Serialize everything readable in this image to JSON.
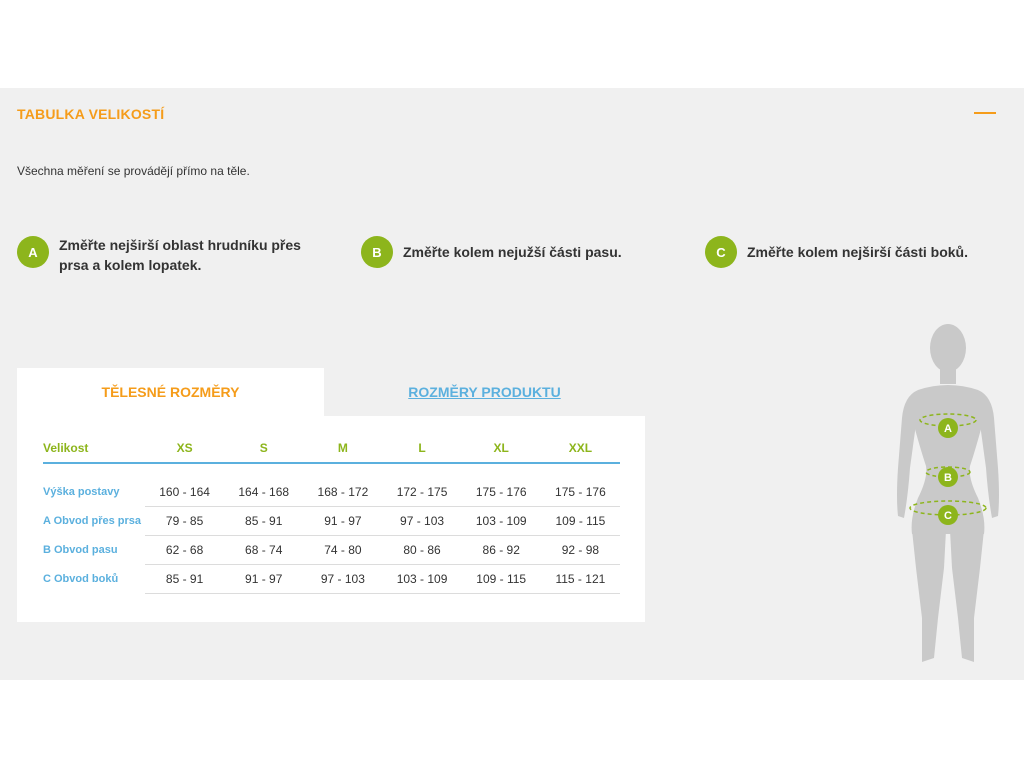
{
  "header": {
    "title": "TABULKA VELIKOSTÍ"
  },
  "intro": "Všechna měření se provádějí přímo na těle.",
  "steps": [
    {
      "badge": "A",
      "text": "Změřte nejširší oblast hrudníku přes prsa a kolem lopatek."
    },
    {
      "badge": "B",
      "text": "Změřte kolem nejužší části pasu."
    },
    {
      "badge": "C",
      "text": "Změřte kolem nejširší části boků."
    }
  ],
  "tabs": [
    {
      "label": "TĚLESNÉ ROZMĚRY",
      "active": true
    },
    {
      "label": "ROZMĚRY PRODUKTU",
      "active": false
    }
  ],
  "table": {
    "headers": [
      "Velikost",
      "XS",
      "S",
      "M",
      "L",
      "XL",
      "XXL"
    ],
    "rows": [
      {
        "label": "Výška postavy",
        "values": [
          "160 - 164",
          "164 - 168",
          "168 - 172",
          "172 - 175",
          "175 - 176",
          "175 - 176"
        ]
      },
      {
        "label": "A Obvod přes prsa",
        "values": [
          "79 - 85",
          "85 - 91",
          "91 - 97",
          "97 - 103",
          "103 - 109",
          "109 - 115"
        ]
      },
      {
        "label": "B Obvod pasu",
        "values": [
          "62 - 68",
          "68 - 74",
          "74 - 80",
          "80 - 86",
          "86 - 92",
          "92 - 98"
        ]
      },
      {
        "label": "C Obvod boků",
        "values": [
          "85 - 91",
          "91 - 97",
          "97 - 103",
          "103 - 109",
          "109 - 115",
          "115 - 121"
        ]
      }
    ]
  },
  "figure": {
    "markers": [
      "A",
      "B",
      "C"
    ],
    "icon": "body-silhouette-icon"
  },
  "colors": {
    "accent": "#f59c1a",
    "green": "#8db51c",
    "blue": "#5bb0de",
    "panel_bg": "#f0f0f0",
    "silhouette": "#c9c9c9"
  }
}
